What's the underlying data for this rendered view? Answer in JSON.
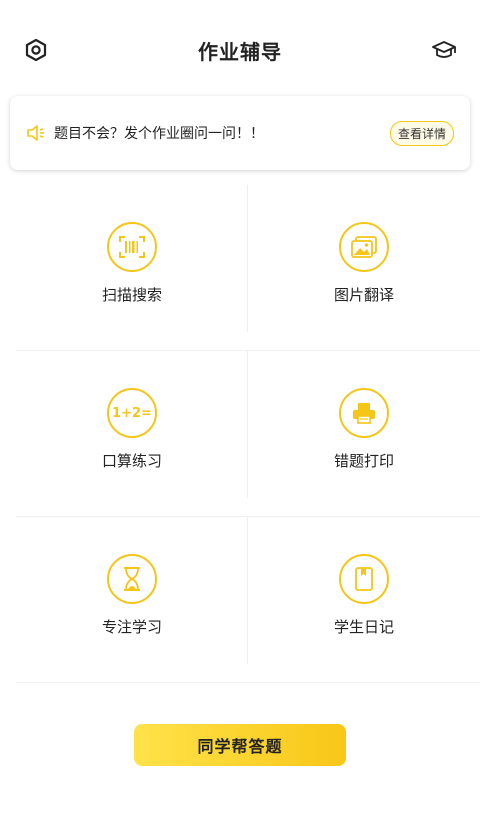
{
  "header": {
    "title": "作业辅导",
    "left_icon": "settings-icon",
    "right_icon": "graduation-cap-icon"
  },
  "notice": {
    "icon": "speaker-icon",
    "text": "题目不会？发个作业圈问一问！！",
    "detail_label": "查看详情"
  },
  "features": [
    {
      "label": "扫描搜索",
      "icon": "barcode-scan-icon"
    },
    {
      "label": "图片翻译",
      "icon": "image-icon"
    },
    {
      "label": "口算练习",
      "icon": "math-icon",
      "icon_text": "1+2="
    },
    {
      "label": "错题打印",
      "icon": "printer-icon"
    },
    {
      "label": "专注学习",
      "icon": "hourglass-icon"
    },
    {
      "label": "学生日记",
      "icon": "notebook-icon"
    }
  ],
  "cta": {
    "label": "同学帮答题"
  },
  "colors": {
    "accent": "#f5c518",
    "text": "#222222"
  }
}
